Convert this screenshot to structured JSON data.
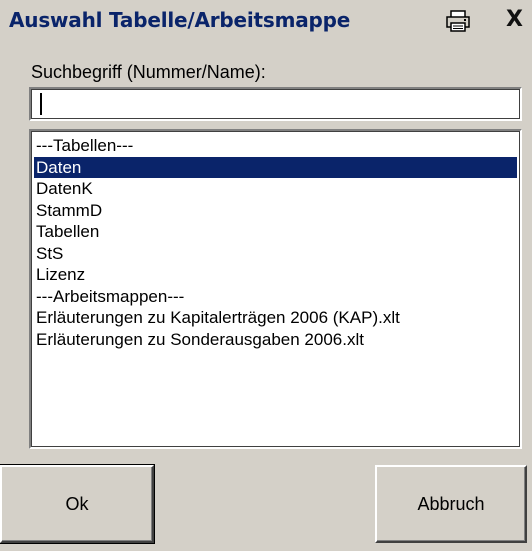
{
  "window": {
    "title": "Auswahl Tabelle/Arbeitsmappe",
    "print_icon": "printer-icon",
    "close_label": "X"
  },
  "search": {
    "label": "Suchbegriff (Nummer/Name):",
    "value": "",
    "placeholder": ""
  },
  "list": {
    "items": [
      {
        "label": "---Tabellen---",
        "selected": false
      },
      {
        "label": "Daten",
        "selected": true
      },
      {
        "label": "DatenK",
        "selected": false
      },
      {
        "label": "StammD",
        "selected": false
      },
      {
        "label": "Tabellen",
        "selected": false
      },
      {
        "label": "StS",
        "selected": false
      },
      {
        "label": "Lizenz",
        "selected": false
      },
      {
        "label": "---Arbeitsmappen---",
        "selected": false
      },
      {
        "label": "Erläuterungen zu Kapitalerträgen 2006 (KAP).xlt",
        "selected": false
      },
      {
        "label": "Erläuterungen zu Sonderausgaben 2006.xlt",
        "selected": false
      }
    ],
    "selection_color": "#0a246a"
  },
  "buttons": {
    "ok_label": "Ok",
    "cancel_label": "Abbruch"
  },
  "colors": {
    "dialog_bg": "#d4d0c8",
    "title_text": "#0a246a"
  }
}
